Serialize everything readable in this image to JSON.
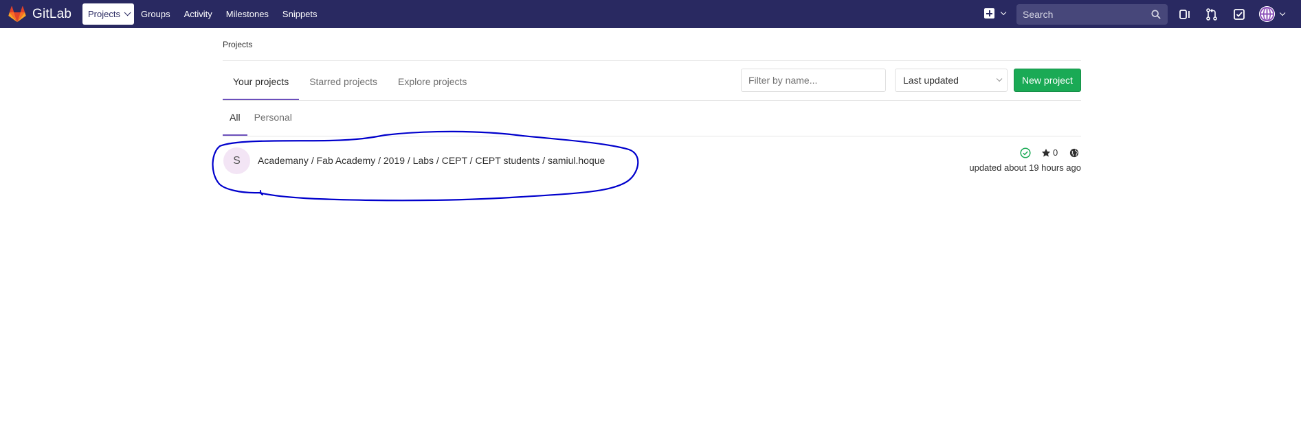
{
  "navbar": {
    "brand": "GitLab",
    "links": [
      {
        "label": "Projects",
        "active": true
      },
      {
        "label": "Groups"
      },
      {
        "label": "Activity"
      },
      {
        "label": "Milestones"
      },
      {
        "label": "Snippets"
      }
    ],
    "search_placeholder": "Search",
    "icons": [
      "plus-square-icon",
      "search-icon",
      "sidebar-toggle-icon",
      "merge-request-icon",
      "todo-check-icon",
      "user-avatar-icon"
    ],
    "bg_color": "#292961"
  },
  "breadcrumb": "Projects",
  "tabs": [
    {
      "label": "Your projects",
      "active": true
    },
    {
      "label": "Starred projects"
    },
    {
      "label": "Explore projects"
    }
  ],
  "filter": {
    "placeholder": "Filter by name..."
  },
  "sort": {
    "selected": "Last updated"
  },
  "new_project_label": "New project",
  "subtabs": [
    {
      "label": "All",
      "active": true
    },
    {
      "label": "Personal"
    }
  ],
  "projects": [
    {
      "avatar_letter": "S",
      "path": "Academany / Fab Academy / 2019 / Labs / CEPT / CEPT students / samiul.hoque",
      "stars": "0",
      "updated": "updated about 19 hours ago",
      "status": "passed",
      "visibility": "public"
    }
  ],
  "colors": {
    "accent": "#6b4fbb",
    "success": "#1aaa55",
    "annotation": "#0000cc"
  }
}
